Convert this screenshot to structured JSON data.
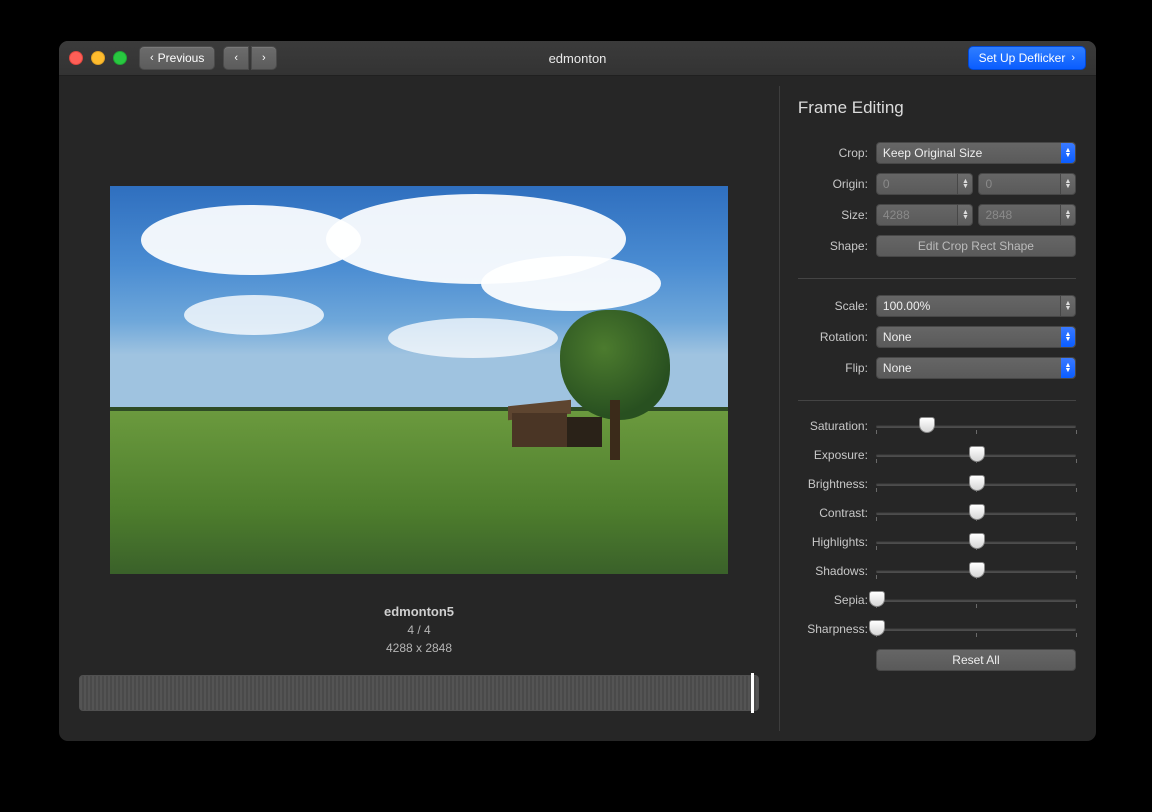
{
  "window": {
    "title": "edmonton",
    "previous_label": "Previous",
    "setup_label": "Set Up Deflicker"
  },
  "preview": {
    "filename": "edmonton5",
    "frame_index": "4 / 4",
    "dimensions": "4288 x 2848"
  },
  "sidebar": {
    "heading": "Frame Editing",
    "crop": {
      "label": "Crop:",
      "value": "Keep Original Size",
      "origin_label": "Origin:",
      "origin_x": "0",
      "origin_y": "0",
      "size_label": "Size:",
      "size_w": "4288",
      "size_h": "2848",
      "shape_label": "Shape:",
      "shape_button": "Edit Crop Rect Shape"
    },
    "transform": {
      "scale_label": "Scale:",
      "scale_value": "100.00%",
      "rotation_label": "Rotation:",
      "rotation_value": "None",
      "flip_label": "Flip:",
      "flip_value": "None"
    },
    "adjust": {
      "saturation": {
        "label": "Saturation:",
        "pos": 25
      },
      "exposure": {
        "label": "Exposure:",
        "pos": 50
      },
      "brightness": {
        "label": "Brightness:",
        "pos": 50
      },
      "contrast": {
        "label": "Contrast:",
        "pos": 50
      },
      "highlights": {
        "label": "Highlights:",
        "pos": 50
      },
      "shadows": {
        "label": "Shadows:",
        "pos": 50
      },
      "sepia": {
        "label": "Sepia:",
        "pos": 0
      },
      "sharpness": {
        "label": "Sharpness:",
        "pos": 0
      }
    },
    "reset_label": "Reset All"
  }
}
